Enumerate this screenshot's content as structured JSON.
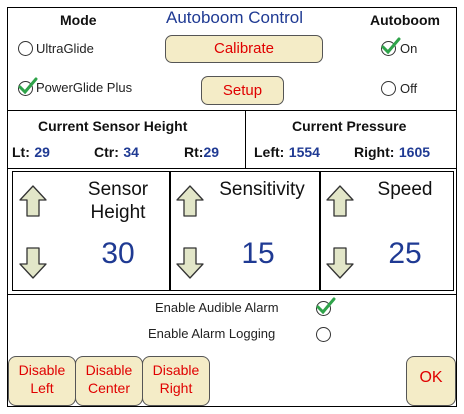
{
  "header": {
    "mode_label": "Mode",
    "title": "Autoboom Control",
    "autoboom_label": "Autoboom"
  },
  "mode": {
    "ultraglide_label": "UltraGlide",
    "powerglide_label": "PowerGlide Plus",
    "selected": "PowerGlide Plus"
  },
  "buttons": {
    "calibrate": "Calibrate",
    "setup": "Setup",
    "disable_left": [
      "Disable",
      "Left"
    ],
    "disable_center": [
      "Disable",
      "Center"
    ],
    "disable_right": [
      "Disable",
      "Right"
    ],
    "ok": "OK"
  },
  "autoboom": {
    "on_label": "On",
    "off_label": "Off",
    "selected": "On"
  },
  "sensor_height_section": {
    "title": "Current Sensor Height",
    "lt_label": "Lt:",
    "lt_value": "29",
    "ctr_label": "Ctr:",
    "ctr_value": "34",
    "rt_label": "Rt:",
    "rt_value": "29"
  },
  "pressure_section": {
    "title": "Current Pressure",
    "left_label": "Left:",
    "left_value": "1554",
    "right_label": "Right:",
    "right_value": "1605"
  },
  "panels": {
    "sensor_height": {
      "title_line1": "Sensor",
      "title_line2": "Height",
      "value": "30"
    },
    "sensitivity": {
      "title": "Sensitivity",
      "value": "15"
    },
    "speed": {
      "title": "Speed",
      "value": "25"
    }
  },
  "alarms": {
    "audible_label": "Enable Audible Alarm",
    "audible_checked": true,
    "logging_label": "Enable Alarm Logging",
    "logging_checked": false
  },
  "colors": {
    "accent_blue": "#1f3a93",
    "button_red": "#e00000",
    "button_bg": "#f4ecc7",
    "check_green": "#2fa34a",
    "arrow_fill": "#e2e6c8"
  }
}
